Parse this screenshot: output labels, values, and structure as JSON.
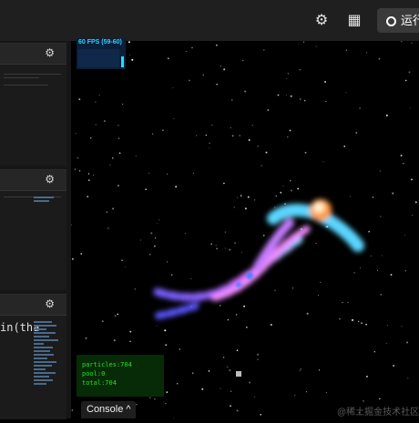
{
  "toolbar": {
    "run_label": "运行"
  },
  "fps_meter": {
    "label": "60 FPS (59-60)"
  },
  "stats": {
    "particles": "particles:704",
    "pool": "pool:0",
    "total": "total:704"
  },
  "console": {
    "label": "Console ^"
  },
  "editor": {
    "code_fragment": "in(tha"
  },
  "watermark": "@稀土掘金技术社区",
  "colors": {
    "accent": "#2fd2ff",
    "stats_text": "#27e127",
    "stats_bg": "#072a07"
  },
  "icons": [
    "settings-icon",
    "layout-icon",
    "run-icon",
    "gear-icon"
  ]
}
